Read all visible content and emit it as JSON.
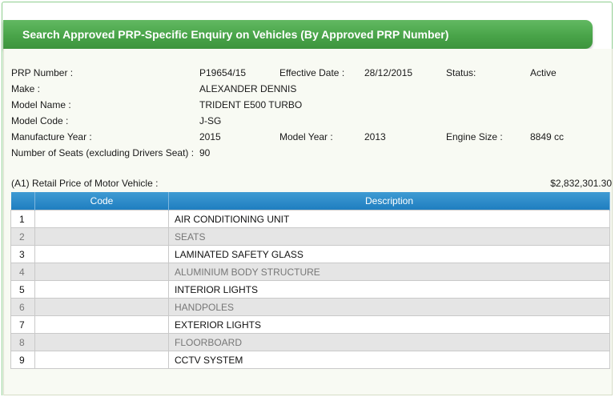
{
  "title": "Search Approved PRP-Specific Enquiry on Vehicles (By Approved PRP Number)",
  "details": {
    "prp_number_label": "PRP Number :",
    "prp_number_value": "P19654/15",
    "effective_date_label": "Effective Date :",
    "effective_date_value": "28/12/2015",
    "status_label": "Status:",
    "status_value": "Active",
    "make_label": "Make :",
    "make_value": "ALEXANDER DENNIS",
    "model_name_label": "Model Name :",
    "model_name_value": "TRIDENT E500 TURBO",
    "model_code_label": "Model Code :",
    "model_code_value": "J-SG",
    "manufacture_year_label": "Manufacture Year :",
    "manufacture_year_value": "2015",
    "model_year_label": "Model Year :",
    "model_year_value": "2013",
    "engine_size_label": "Engine Size :",
    "engine_size_value": "8849 cc",
    "seats_label": "Number of Seats (excluding Drivers Seat) :",
    "seats_value": "90",
    "retail_price_label": "(A1) Retail Price of Motor Vehicle :",
    "retail_price_value": "$2,832,301.30"
  },
  "table": {
    "headers": {
      "code": "Code",
      "description": "Description"
    },
    "rows": [
      {
        "no": "1",
        "code": "",
        "description": "AIR CONDITIONING UNIT"
      },
      {
        "no": "2",
        "code": "",
        "description": "SEATS"
      },
      {
        "no": "3",
        "code": "",
        "description": "LAMINATED SAFETY GLASS"
      },
      {
        "no": "4",
        "code": "",
        "description": "ALUMINIUM BODY STRUCTURE"
      },
      {
        "no": "5",
        "code": "",
        "description": "INTERIOR LIGHTS"
      },
      {
        "no": "6",
        "code": "",
        "description": "HANDPOLES"
      },
      {
        "no": "7",
        "code": "",
        "description": "EXTERIOR LIGHTS"
      },
      {
        "no": "8",
        "code": "",
        "description": "FLOORBOARD"
      },
      {
        "no": "9",
        "code": "",
        "description": "CCTV SYSTEM"
      }
    ]
  },
  "colors": {
    "title_bar": "#4aa64a",
    "table_header": "#2a88c8",
    "frame_border": "#8fce8f"
  }
}
